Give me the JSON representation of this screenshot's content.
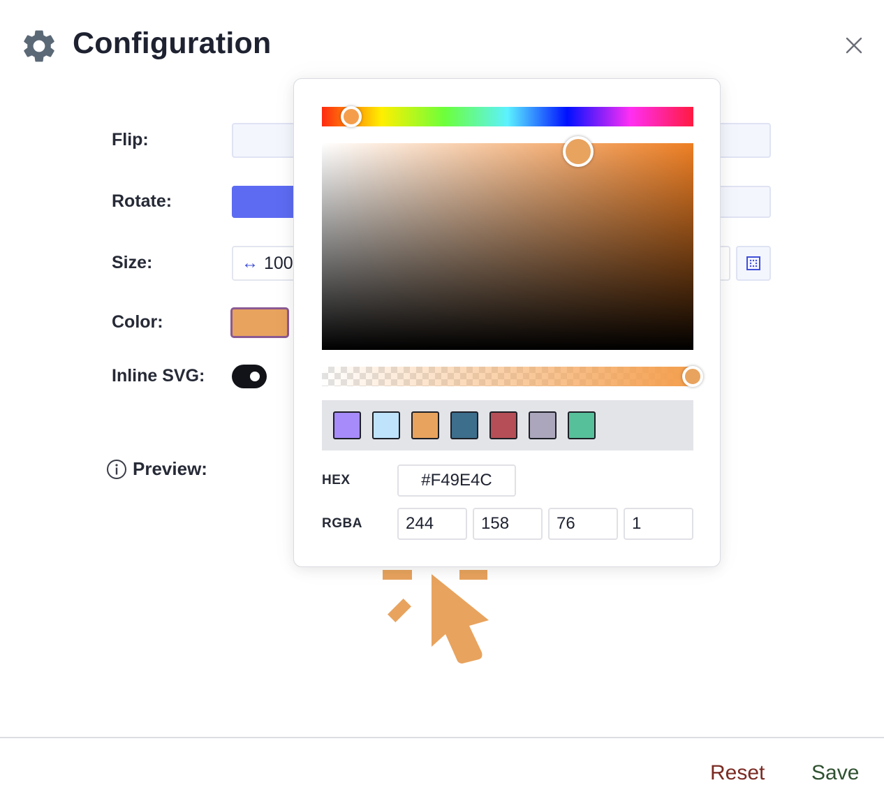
{
  "header": {
    "title": "Configuration",
    "icon": "gear-icon",
    "close_icon": "close-icon"
  },
  "form": {
    "flip_label": "Flip:",
    "rotate_label": "Rotate:",
    "size_label": "Size:",
    "size_value": "100",
    "color_label": "Color:",
    "color_value": "#E8A35E",
    "inline_svg_label": "Inline SVG:",
    "inline_svg_on": true,
    "preview_label": "Preview:"
  },
  "picker": {
    "presets": [
      "#a78bfa",
      "#bfe3fb",
      "#e8a35e",
      "#3d6e8c",
      "#b54e56",
      "#aca6bc",
      "#56c09a"
    ],
    "hex_label": "HEX",
    "hex_value": "#F49E4C",
    "rgba_label": "RGBA",
    "r": "244",
    "g": "158",
    "b": "76",
    "a": "1"
  },
  "footer": {
    "reset_label": "Reset",
    "save_label": "Save"
  },
  "colors": {
    "accent": "#5d6bf2",
    "preview_color": "#E8A35E",
    "reset": "#7a2a22",
    "save": "#2f5130"
  }
}
